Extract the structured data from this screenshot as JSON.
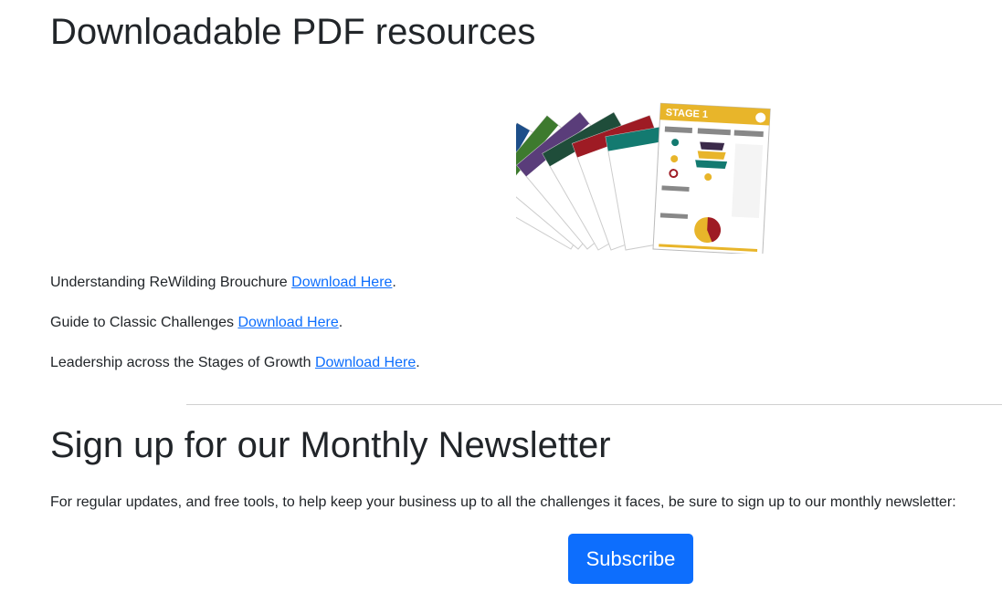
{
  "pdf_section": {
    "title": "Downloadable PDF resources",
    "brochure_heading": "STAGE 1",
    "resources": [
      {
        "label": "Understanding ReWilding Brouchure ",
        "link_text": "Download Here",
        "suffix": "."
      },
      {
        "label": "Guide to Classic Challenges ",
        "link_text": "Download Here",
        "suffix": "."
      },
      {
        "label": "Leadership across the Stages of Growth ",
        "link_text": "Download Here",
        "suffix": "."
      }
    ]
  },
  "newsletter": {
    "title": "Sign up for our Monthly Newsletter",
    "description": "For regular updates, and free tools, to help keep your business up to all the challenges it faces, be sure to sign up to our monthly newsletter:",
    "subscribe_label": "Subscribe"
  },
  "colors": {
    "link": "#0d6efd",
    "button": "#0d6efd",
    "stage_cards": [
      "#1d4e89",
      "#3d7a2e",
      "#5a3d7a",
      "#1f4d3a",
      "#9e1b24",
      "#137a70",
      "#e8b52a"
    ]
  }
}
